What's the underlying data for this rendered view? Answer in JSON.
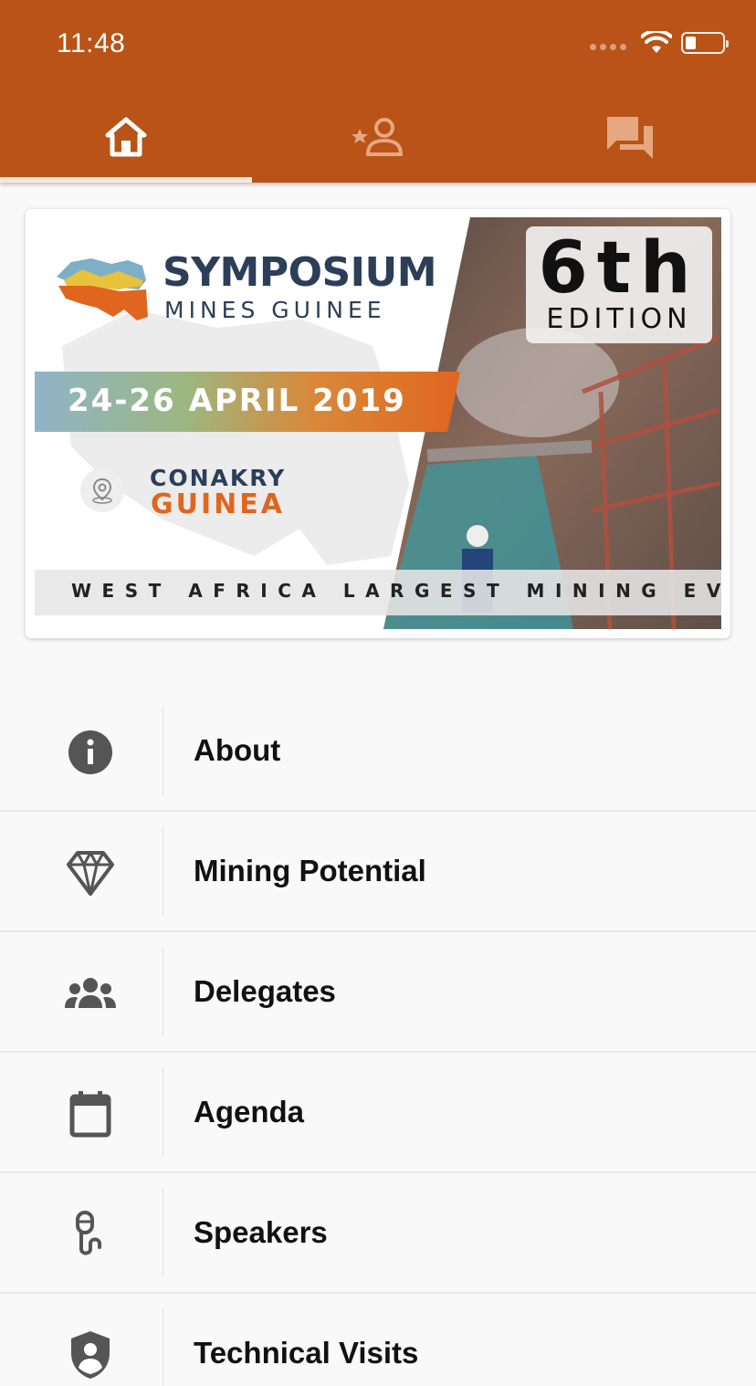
{
  "status_bar": {
    "time": "11:48"
  },
  "tabs": [
    {
      "name": "home",
      "icon": "home-icon",
      "active": true
    },
    {
      "name": "favorites",
      "icon": "person-star-icon",
      "active": false
    },
    {
      "name": "chat",
      "icon": "chat-icon",
      "active": false
    }
  ],
  "banner": {
    "title_line1": "SYMPOSIUM",
    "title_line2": "MINES GUINEE",
    "dates": "24-26 APRIL 2019",
    "city": "CONAKRY",
    "country": "GUINEA",
    "edition_number": "6th",
    "edition_word": "EDITION",
    "tagline": "WEST AFRICA LARGEST MINING EVENT"
  },
  "menu": [
    {
      "label": "About",
      "icon": "info-icon"
    },
    {
      "label": "Mining Potential",
      "icon": "diamond-icon"
    },
    {
      "label": "Delegates",
      "icon": "group-icon"
    },
    {
      "label": "Agenda",
      "icon": "calendar-icon"
    },
    {
      "label": "Speakers",
      "icon": "microphone-icon"
    },
    {
      "label": "Technical Visits",
      "icon": "shield-person-icon"
    }
  ],
  "colors": {
    "primary": "#b95317",
    "accent_orange": "#e0661f",
    "navy": "#2c3e58",
    "icon_gray": "#555555"
  }
}
